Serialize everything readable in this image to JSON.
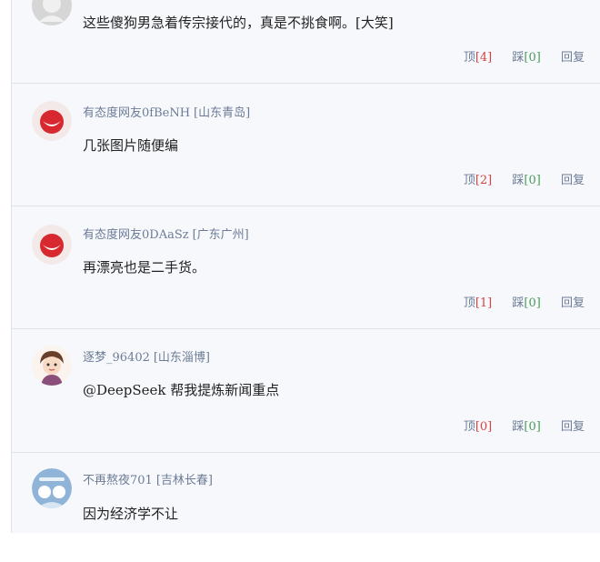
{
  "comments": [
    {
      "user": "",
      "location": "",
      "text": "这些傻狗男急着传宗接代的，真是不挑食啊。[大笑]",
      "up_label": "顶",
      "up_count": "[4]",
      "down_label": "踩",
      "down_count": "[0]",
      "reply_label": "回复"
    },
    {
      "user": "有态度网友0fBeNH",
      "location": "[山东青岛]",
      "text": "几张图片随便编",
      "up_label": "顶",
      "up_count": "[2]",
      "down_label": "踩",
      "down_count": "[0]",
      "reply_label": "回复"
    },
    {
      "user": "有态度网友0DAaSz",
      "location": "[广东广州]",
      "text": "再漂亮也是二手货。",
      "up_label": "顶",
      "up_count": "[1]",
      "down_label": "踩",
      "down_count": "[0]",
      "reply_label": "回复"
    },
    {
      "user": "逐梦_96402",
      "location": "[山东淄博]",
      "text": "@DeepSeek 帮我提炼新闻重点",
      "up_label": "顶",
      "up_count": "[0]",
      "down_label": "踩",
      "down_count": "[0]",
      "reply_label": "回复"
    },
    {
      "user": "不再熬夜701",
      "location": "[吉林长春]",
      "text": "因为经济学不让"
    }
  ],
  "colors": {
    "up": "#d04444",
    "down": "#4a9a5a",
    "meta": "#6c7c96"
  }
}
